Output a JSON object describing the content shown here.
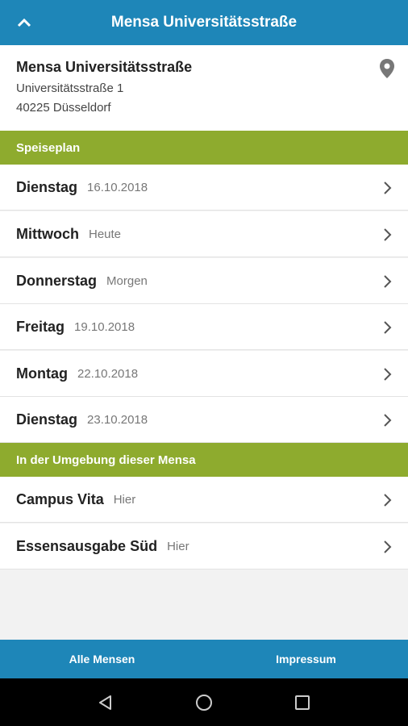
{
  "appbar": {
    "title": "Mensa Universitätsstraße"
  },
  "header": {
    "name": "Mensa Universitätsstraße",
    "street": "Universitätsstraße 1",
    "city": "40225 Düsseldorf"
  },
  "sections": {
    "menu": "Speiseplan",
    "nearby": "In der Umgebung dieser Mensa"
  },
  "menu_days": [
    {
      "day": "Dienstag",
      "sub": "16.10.2018"
    },
    {
      "day": "Mittwoch",
      "sub": "Heute"
    },
    {
      "day": "Donnerstag",
      "sub": "Morgen"
    },
    {
      "day": "Freitag",
      "sub": "19.10.2018"
    },
    {
      "day": "Montag",
      "sub": "22.10.2018"
    },
    {
      "day": "Dienstag",
      "sub": "23.10.2018"
    }
  ],
  "nearby": [
    {
      "name": "Campus Vita",
      "sub": "Hier"
    },
    {
      "name": "Essensausgabe Süd",
      "sub": "Hier"
    }
  ],
  "bottom_tabs": {
    "all": "Alle Mensen",
    "imprint": "Impressum"
  },
  "colors": {
    "primary": "#1e86b8",
    "accent": "#8eab2e"
  }
}
